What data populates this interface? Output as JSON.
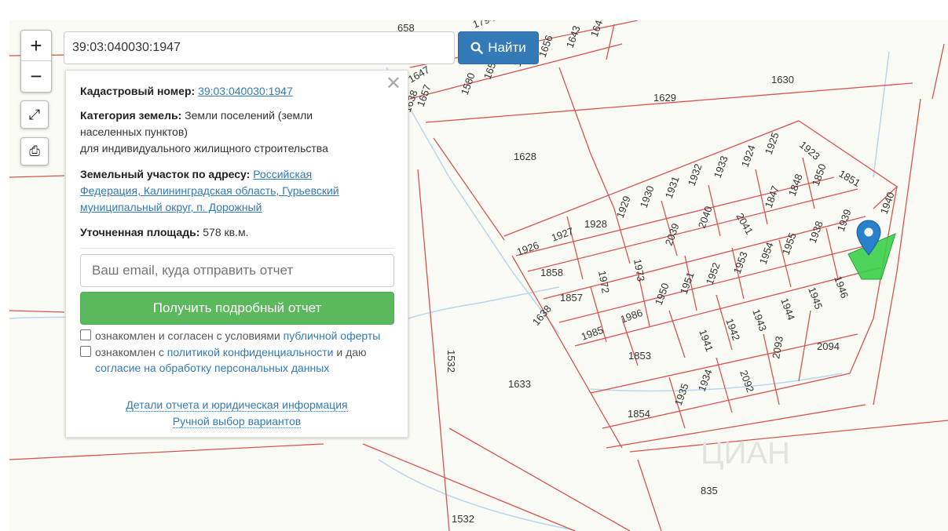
{
  "search": {
    "value": "39:03:040030:1947",
    "button_label": "Найти"
  },
  "controls": {
    "zoom_in": "+",
    "zoom_out": "−"
  },
  "panel": {
    "cadastral_label": "Кадастровый номер:",
    "cadastral_value": "39:03:040030:1947",
    "category_label": "Категория земель:",
    "category_value_1": "Земли поселений (земли",
    "category_value_2": "населенных пунктов)",
    "category_value_3": "для индивидуального жилищного строительства",
    "address_label": "Земельный участок по адресу:",
    "address_value_1": "Российская",
    "address_value_2": "Федерация, Калининградская область, Гурьевский",
    "address_value_3": "муниципальный округ, п. Дорожный",
    "area_label": "Уточненная площадь:",
    "area_value": "578 кв.м.",
    "email_placeholder": "Ваш email, куда отправить отчет",
    "report_button": "Получить подробный отчет",
    "check1_text": "ознакомлен и согласен с условиями",
    "check1_link": "публичной оферты",
    "check2_text": "ознакомлен с",
    "check2_link": "политикой конфиденциальности",
    "check2_tail": "и даю",
    "check2_link2": "согласие на обработку персональных данных",
    "details_link": "Детали отчета и юридическая информация",
    "manual_link": "Ручной выбор вариантов"
  },
  "map": {
    "parcel_color": "#d9534f",
    "selected_color": "#3ad04a",
    "marker_color": "#2a81cb",
    "watermark": "ЦИАН",
    "labels": [
      "658",
      "1794",
      "1644",
      "1643",
      "1656",
      "1655",
      "1654",
      "1580",
      "1657",
      "1647",
      "1638",
      "1630",
      "1629",
      "1628",
      "1923",
      "1925",
      "1924",
      "1933",
      "1932",
      "1931",
      "1930",
      "1929",
      "1928",
      "1927",
      "1926",
      "1851",
      "1850",
      "1848",
      "1847",
      "2041",
      "2040",
      "2039",
      "1973",
      "1972",
      "1858",
      "1857",
      "1940",
      "1939",
      "1938",
      "1955",
      "1954",
      "1953",
      "1952",
      "1951",
      "1950",
      "1986",
      "1985",
      "1946",
      "1945",
      "1944",
      "1943",
      "1942",
      "1941",
      "1853",
      "2094",
      "2093",
      "2092",
      "1934",
      "1935",
      "1854",
      "1638",
      "1532",
      "1633",
      "835",
      "1532"
    ]
  }
}
